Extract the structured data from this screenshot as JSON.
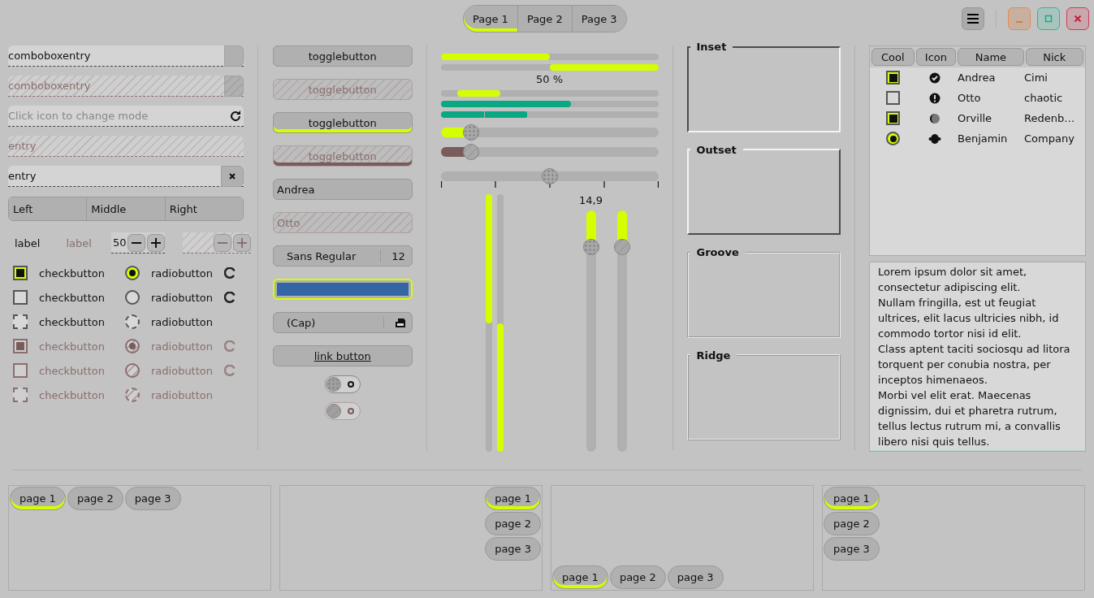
{
  "header": {
    "tabs": [
      {
        "label": "Page 1",
        "selected": true
      },
      {
        "label": "Page 2",
        "selected": false
      },
      {
        "label": "Page 3",
        "selected": false
      }
    ]
  },
  "entries": [
    {
      "kind": "combo",
      "value": "comboboxentry",
      "disabled": false
    },
    {
      "kind": "combo",
      "value": "comboboxentry",
      "disabled": true
    },
    {
      "kind": "icon",
      "placeholder": "Click icon to change mode",
      "disabled": false
    },
    {
      "kind": "plain",
      "value": "entry",
      "disabled": true
    },
    {
      "kind": "clear",
      "value": "entry",
      "disabled": false
    }
  ],
  "segments": [
    "Left",
    "Middle",
    "Right"
  ],
  "labels": [
    {
      "text": "label",
      "disabled": false
    },
    {
      "text": "label",
      "disabled": true
    }
  ],
  "spins": [
    {
      "value": "50",
      "disabled": false
    },
    {
      "disabled": true
    }
  ],
  "checks": [
    {
      "label": "checkbutton",
      "checked": true,
      "disabled": false
    },
    {
      "label": "checkbutton",
      "checked": false,
      "disabled": false
    },
    {
      "label": "checkbutton",
      "checked": false,
      "inconsistent": true,
      "disabled": false
    },
    {
      "label": "checkbutton",
      "checked": true,
      "disabled": true
    },
    {
      "label": "checkbutton",
      "checked": false,
      "disabled": true
    },
    {
      "label": "checkbutton",
      "checked": false,
      "inconsistent": true,
      "disabled": true
    }
  ],
  "radios": [
    {
      "label": "radiobutton",
      "checked": true,
      "disabled": false,
      "spinner": true
    },
    {
      "label": "radiobutton",
      "checked": false,
      "disabled": false,
      "spinner": true
    },
    {
      "label": "radiobutton",
      "checked": false,
      "inconsistent": true,
      "disabled": false,
      "spinner": false
    },
    {
      "label": "radiobutton",
      "checked": true,
      "disabled": true,
      "spinner": true
    },
    {
      "label": "radiobutton",
      "checked": false,
      "disabled": true,
      "spinner": true
    },
    {
      "label": "radiobutton",
      "checked": false,
      "inconsistent": true,
      "disabled": true,
      "spinner": false
    }
  ],
  "toggles": [
    {
      "label": "togglebutton",
      "active": false,
      "disabled": false
    },
    {
      "label": "togglebutton",
      "active": false,
      "disabled": true
    },
    {
      "label": "togglebutton",
      "active": true,
      "disabled": false
    },
    {
      "label": "togglebutton",
      "active": true,
      "disabled": true
    }
  ],
  "combos": [
    {
      "value": "Andrea",
      "disabled": false
    },
    {
      "value": "Otto",
      "disabled": true
    }
  ],
  "font_button": {
    "name": "Sans Regular",
    "size": "12"
  },
  "file_button": {
    "label": "(Cap)"
  },
  "link_button": {
    "label": "link button"
  },
  "switches": [
    {
      "on": false,
      "disabled": false
    },
    {
      "on": false,
      "disabled": true
    }
  ],
  "progress": [
    {
      "kind": "normal",
      "level": 0.5
    },
    {
      "kind": "inverted",
      "level": 0.5
    },
    {
      "kind": "pulse",
      "level": 0.2
    }
  ],
  "progress_text": "50 %",
  "level_bars": [
    {
      "kind": "continuous",
      "level": 0.6
    },
    {
      "kind": "discrete",
      "level": 0.4
    }
  ],
  "sliders": [
    {
      "level": 0.14,
      "disabled": false
    },
    {
      "level": 0.14,
      "disabled": true
    },
    {
      "level": 0.5,
      "disabled": false,
      "marks": true
    }
  ],
  "vprogress": [
    {
      "level": 0.5,
      "inverted": false
    },
    {
      "level": 0.5,
      "inverted": true
    }
  ],
  "vsliders": [
    {
      "level": 0.15,
      "value": "14,9",
      "disabled": false
    },
    {
      "level": 0.15,
      "disabled": true
    }
  ],
  "frames": [
    {
      "label": "Inset",
      "kind": "inset"
    },
    {
      "label": "Outset",
      "kind": "outset"
    },
    {
      "label": "Groove",
      "kind": "groove"
    },
    {
      "label": "Ridge",
      "kind": "ridge"
    }
  ],
  "tree": {
    "columns": [
      "Cool",
      "Icon",
      "Name",
      "Nick"
    ],
    "rows": [
      {
        "kind": "check",
        "checked": true,
        "name": "Andrea",
        "nick": "Cimi"
      },
      {
        "kind": "check",
        "checked": false,
        "name": "Otto",
        "nick": "chaotic"
      },
      {
        "kind": "check",
        "checked": true,
        "name": "Orville",
        "nick": "Redenb…"
      },
      {
        "kind": "radio",
        "checked": true,
        "name": "Benjamin",
        "nick": "Company"
      }
    ]
  },
  "text_view": [
    "Lorem ipsum dolor sit amet, consectetur adipiscing elit.",
    "Nullam fringilla, est ut feugiat ultrices, elit lacus ultricies nibh, id commodo tortor nisi id elit.",
    "Class aptent taciti sociosqu ad litora torquent per conubia nostra, per inceptos himenaeos.",
    "Morbi vel elit erat. Maecenas dignissim, dui et pharetra rutrum, tellus lectus rutrum mi, a convallis libero nisi quis tellus."
  ],
  "notebooks": [
    {
      "kind": "top",
      "tabs": [
        {
          "label": "page 1",
          "selected": true
        },
        {
          "label": "page 2",
          "selected": false
        },
        {
          "label": "page 3",
          "selected": false
        }
      ]
    },
    {
      "kind": "right",
      "tabs": [
        {
          "label": "page 1",
          "selected": true
        },
        {
          "label": "page 2",
          "selected": false
        },
        {
          "label": "page 3",
          "selected": false
        }
      ]
    },
    {
      "kind": "bottom",
      "tabs": [
        {
          "label": "page 1",
          "selected": true
        },
        {
          "label": "page 2",
          "selected": false
        },
        {
          "label": "page 3",
          "selected": false
        }
      ]
    },
    {
      "kind": "left",
      "tabs": [
        {
          "label": "page 1",
          "selected": true
        },
        {
          "label": "page 2",
          "selected": false
        },
        {
          "label": "page 3",
          "selected": false
        }
      ]
    }
  ]
}
